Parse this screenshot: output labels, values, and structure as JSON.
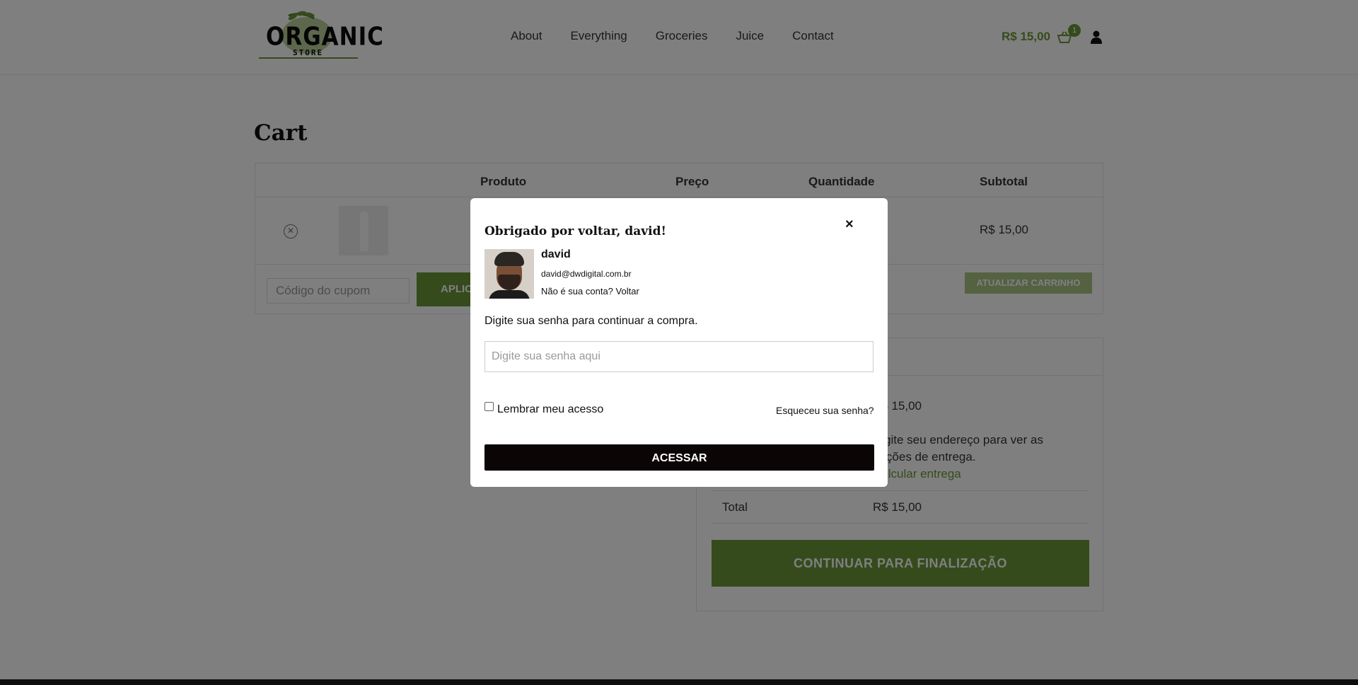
{
  "header": {
    "logo_word": "ORGANIC",
    "logo_sub": "STORE",
    "nav": [
      "About",
      "Everything",
      "Groceries",
      "Juice",
      "Contact"
    ],
    "cart_amount": "R$ 15,00",
    "cart_count": "1"
  },
  "cart": {
    "title": "Cart",
    "columns": {
      "product": "Produto",
      "price": "Preço",
      "quantity": "Quantidade",
      "subtotal": "Subtotal"
    },
    "row": {
      "subtotal": "R$ 15,00"
    },
    "coupon_placeholder": "Código do cupom",
    "apply_label": "APLICAR CUPOM",
    "update_label": "ATUALIZAR CARRINHO"
  },
  "totals": {
    "subtotal_value": "R$ 15,00",
    "shipping_text": "Digite seu endereço para ver as opções de entrega.",
    "shipping_link": "Calcular entrega",
    "total_label": "Total",
    "total_value": "R$ 15,00",
    "checkout_label": "CONTINUAR PARA FINALIZAÇÃO"
  },
  "modal": {
    "title": "Obrigado por voltar, david!",
    "close": "×",
    "name": "david",
    "email": "david@dwdigital.com.br",
    "not_you": "Não é sua conta?",
    "back": "Voltar",
    "prompt": "Digite sua senha para continuar a compra.",
    "password_placeholder": "Digite sua senha aqui",
    "remember": "Lembrar meu acesso",
    "forgot": "Esqueceu sua senha?",
    "submit": "ACESSAR"
  },
  "colors": {
    "accent": "#6a9739",
    "overlay": "rgba(0,0,0,0.5)",
    "button_dark": "#0c0505"
  }
}
